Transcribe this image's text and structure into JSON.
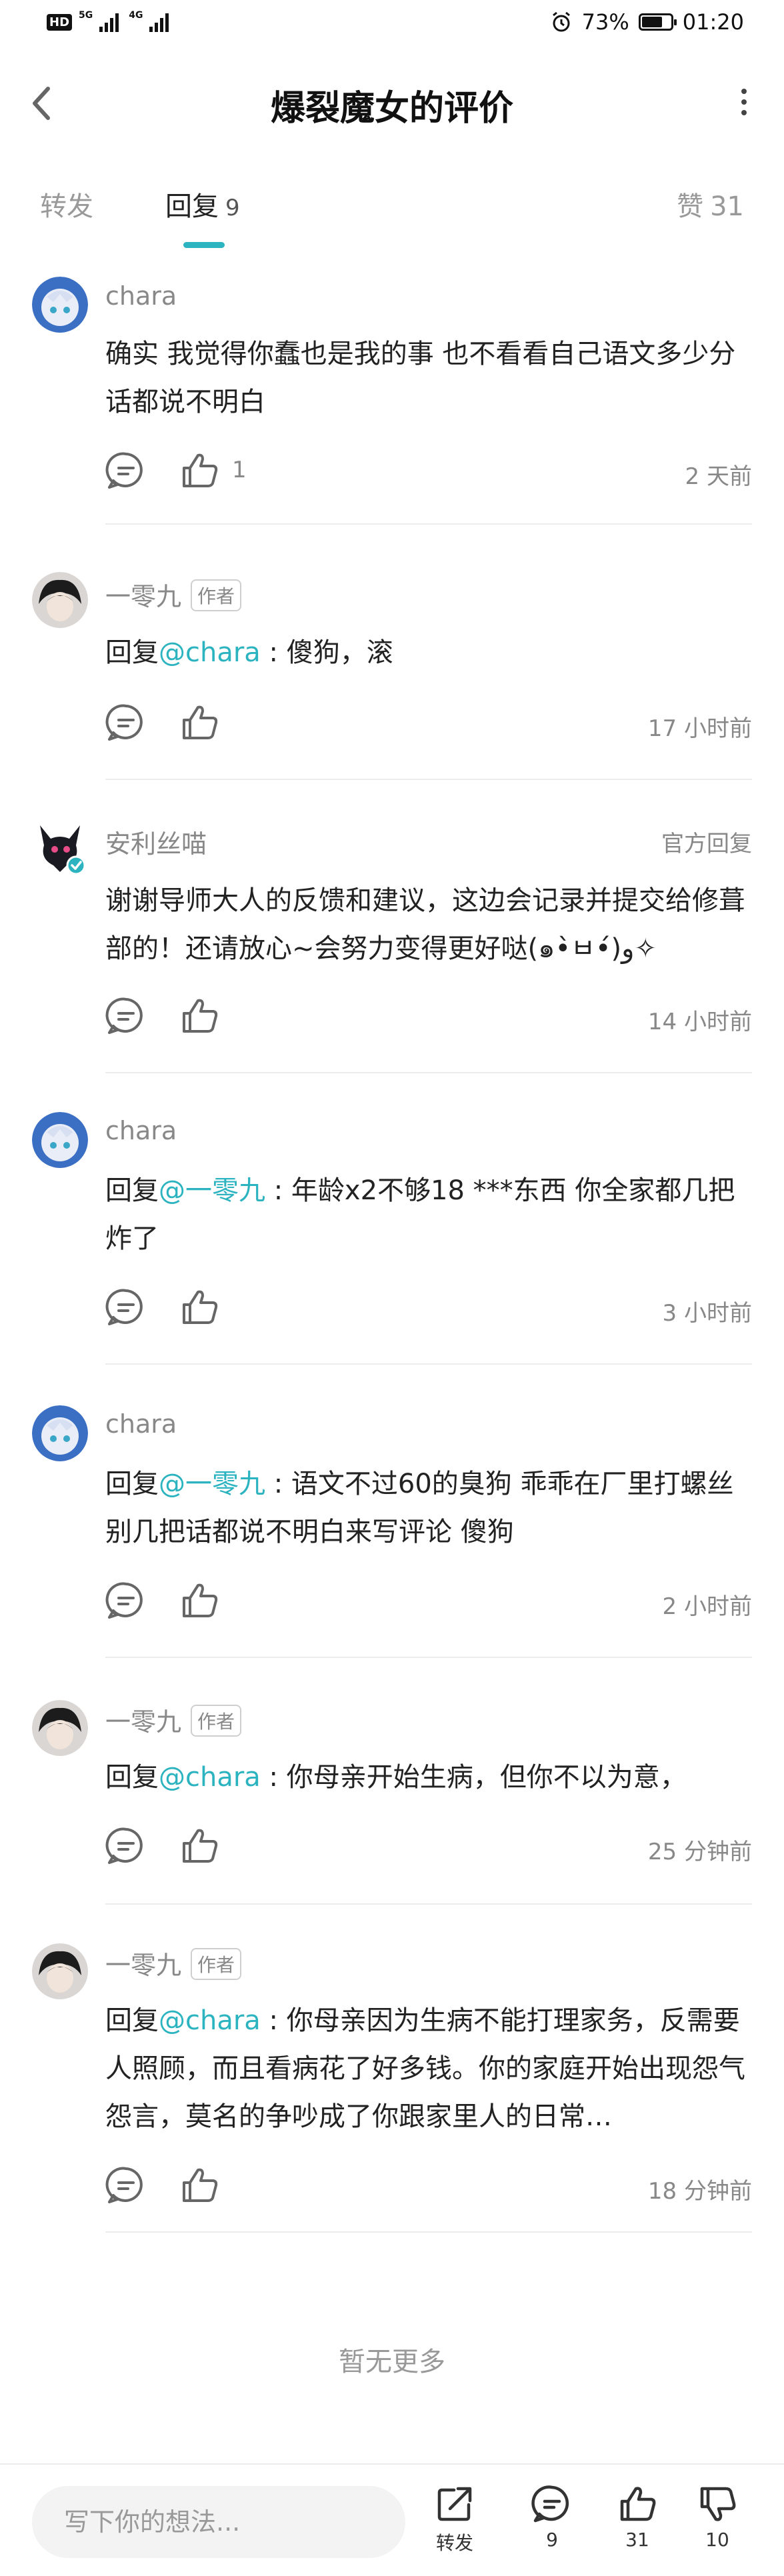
{
  "status_bar": {
    "hd_badge": "HD",
    "sim1": "5G",
    "sim2": "4G",
    "battery_text": "73%",
    "battery_level": 0.73,
    "time": "01:20"
  },
  "header": {
    "title": "爆裂魔女的评价",
    "back_icon": "chevron-left-icon",
    "more_icon": "more-vertical-icon"
  },
  "tabs": {
    "repost": "转发",
    "reply": "回复",
    "reply_count": "9",
    "like": "赞",
    "like_count": "31"
  },
  "replies": [
    {
      "user": "chara",
      "reply_prefix": "",
      "mention": "",
      "separator": "",
      "text": "确实 我觉得你蠢也是我的事 也不看看自己语文多少分 话都说不明白",
      "like_count": "1",
      "time": "2 天前"
    },
    {
      "user": "一零九",
      "author_badge": "作者",
      "reply_prefix": "回复",
      "mention": "@chara",
      "separator": " : ",
      "text": "傻狗，滚",
      "like_count": "",
      "time": "17 小时前"
    },
    {
      "user": "安利丝喵",
      "official_tag": "官方回复",
      "reply_prefix": "",
      "mention": "",
      "separator": "",
      "text": "谢谢导师大人的反馈和建议，这边会记录并提交给修葺部的！还请放心~会努力变得更好哒(๑•̀ㅂ•́)و✧",
      "like_count": "",
      "time": "14 小时前"
    },
    {
      "user": "chara",
      "reply_prefix": "回复",
      "mention": "@一零九",
      "separator": " : ",
      "text": "年龄x2不够18 ***东西 你全家都几把炸了",
      "like_count": "",
      "time": "3 小时前"
    },
    {
      "user": "chara",
      "reply_prefix": "回复",
      "mention": "@一零九",
      "separator": " : ",
      "text": "语文不过60的臭狗 乖乖在厂里打螺丝 别几把话都说不明白来写评论 傻狗",
      "like_count": "",
      "time": "2 小时前"
    },
    {
      "user": "一零九",
      "author_badge": "作者",
      "reply_prefix": "回复",
      "mention": "@chara",
      "separator": " : ",
      "text": "你母亲开始生病，但你不以为意，",
      "like_count": "",
      "time": "25 分钟前"
    },
    {
      "user": "一零九",
      "author_badge": "作者",
      "reply_prefix": "回复",
      "mention": "@chara",
      "separator": " : ",
      "text": "你母亲因为生病不能打理家务，反需要人照顾，而且看病花了好多钱。你的家庭开始出现怨气怨言，莫名的争吵成了你跟家里人的日常…",
      "like_count": "",
      "time": "18 分钟前"
    }
  ],
  "no_more_text": "暂无更多",
  "bottom_bar": {
    "input_placeholder": "写下你的想法...",
    "share_label": "转发",
    "comment_count": "9",
    "like_count": "31",
    "dislike_count": "10"
  },
  "colors": {
    "accent": "#2bb3c0",
    "text_primary": "#222222",
    "text_secondary": "#888888",
    "divider": "#ececec"
  }
}
